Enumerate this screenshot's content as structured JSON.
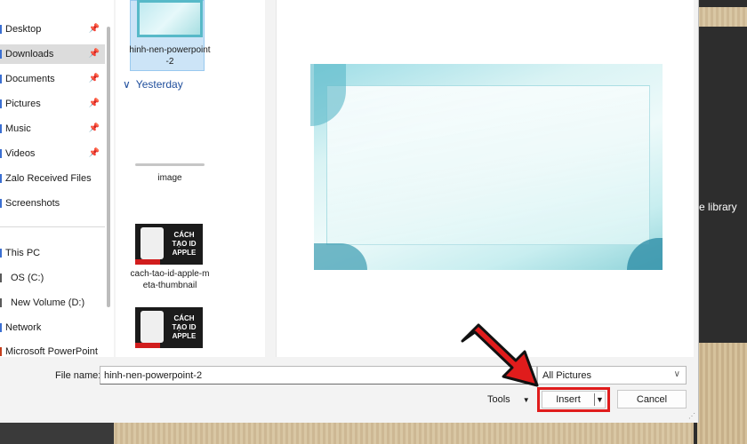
{
  "background_app": {
    "side_text": "e library"
  },
  "nav": {
    "items": [
      {
        "label": "Desktop",
        "pinned": true,
        "selected": false
      },
      {
        "label": "Downloads",
        "pinned": true,
        "selected": true
      },
      {
        "label": "Documents",
        "pinned": true,
        "selected": false
      },
      {
        "label": "Pictures",
        "pinned": true,
        "selected": false
      },
      {
        "label": "Music",
        "pinned": true,
        "selected": false
      },
      {
        "label": "Videos",
        "pinned": true,
        "selected": false
      },
      {
        "label": "Zalo Received Files",
        "pinned": false,
        "selected": false
      },
      {
        "label": "Screenshots",
        "pinned": false,
        "selected": false
      },
      {
        "label": "This PC",
        "pinned": false,
        "selected": false
      },
      {
        "label": "OS (C:)",
        "pinned": false,
        "selected": false
      },
      {
        "label": "New Volume (D:)",
        "pinned": false,
        "selected": false
      },
      {
        "label": "Network",
        "pinned": false,
        "selected": false
      },
      {
        "label": "Microsoft PowerPoint",
        "pinned": false,
        "selected": false
      }
    ],
    "pin_icon": "pin-icon"
  },
  "files": {
    "group_header": "Yesterday",
    "items": [
      {
        "label": "hinh-nen-powerpoint-2",
        "selected": true
      },
      {
        "label": "image",
        "selected": false
      },
      {
        "label": "cach-tao-id-apple-meta-thumbnail",
        "selected": false,
        "thumb_text": "CÁCH TẠO ID APPLE"
      },
      {
        "label": "",
        "selected": false,
        "thumb_text": "CÁCH TẠO ID APPLE"
      }
    ]
  },
  "footer": {
    "file_name_label": "File name:",
    "file_name_value": "hinh-nen-powerpoint-2",
    "file_type": "All Pictures",
    "tools_label": "Tools",
    "insert_label": "Insert",
    "cancel_label": "Cancel"
  },
  "colors": {
    "highlight_red": "#e01c1c",
    "selection_blue": "#cce4f7",
    "group_header_blue": "#1f4e9c"
  }
}
